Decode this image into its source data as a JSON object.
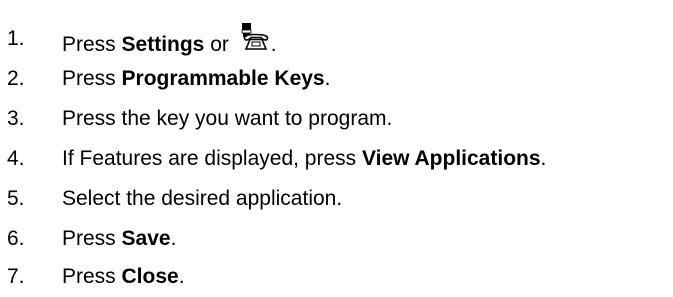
{
  "steps": [
    {
      "number": "1.",
      "pre": "Press ",
      "bold": "Settings",
      "mid": " or ",
      "icon": "settings-phone-icon",
      "post": "."
    },
    {
      "number": "2.",
      "pre": "Press ",
      "bold": "Programmable Keys",
      "post": "."
    },
    {
      "number": "3.",
      "pre": "Press the key you want to program."
    },
    {
      "number": "4.",
      "pre": "If Features are displayed, press ",
      "bold": "View Applications",
      "post": "."
    },
    {
      "number": "5.",
      "pre": "Select the desired application."
    },
    {
      "number": "6.",
      "pre": "Press ",
      "bold": "Save",
      "post": "."
    },
    {
      "number": "7.",
      "pre": "Press ",
      "bold": "Close",
      "post": "."
    }
  ]
}
